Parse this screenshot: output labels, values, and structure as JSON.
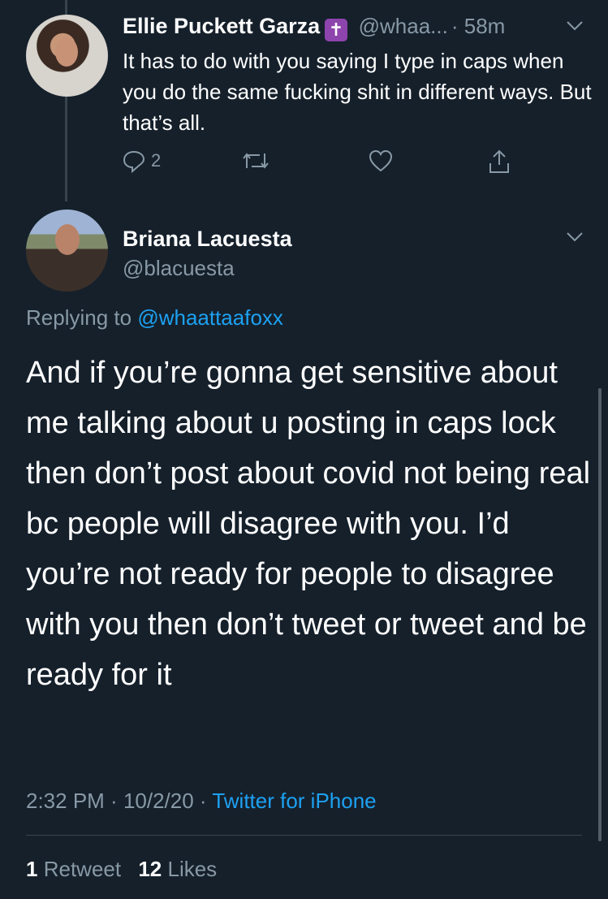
{
  "parent_tweet": {
    "name": "Ellie Puckett Garza",
    "badge_icon": "cross-icon",
    "handle": "@whaa...",
    "time": "· 58m",
    "text": "It has to do with you saying I type in caps when you do the same fucking shit in different ways. But that’s all.",
    "reply_count": "2"
  },
  "main_tweet": {
    "name": "Briana Lacuesta",
    "handle": "@blacuesta",
    "replying_prefix": "Replying to",
    "replying_handle": "@whaattaafoxx",
    "text": "And if you’re gonna get sensitive about me talking about u posting in caps lock then don’t post about covid not being real bc people will disagree with you. I’d you’re not ready for people to disagree with you then don’t tweet or tweet and be ready for it",
    "time": "2:32 PM",
    "date": "10/2/20",
    "source": "Twitter for iPhone",
    "retweet_count": "1",
    "retweet_label": "Retweet",
    "like_count": "12",
    "like_label": "Likes"
  },
  "colors": {
    "background": "#15202b",
    "text": "#ffffff",
    "muted": "#8899a6",
    "accent": "#1da1f2",
    "divider": "#38444d",
    "badge": "#8e44ad"
  }
}
